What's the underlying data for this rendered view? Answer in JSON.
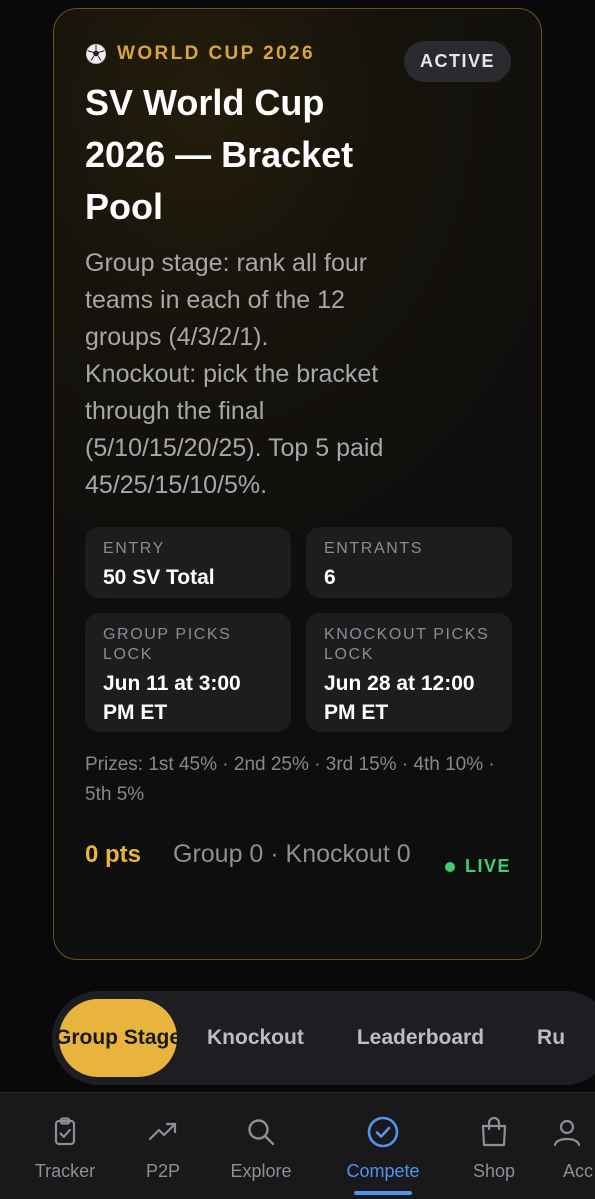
{
  "pool": {
    "eyebrow": "WORLD CUP 2026",
    "eyebrow_icon": "soccer-ball-icon",
    "status": "ACTIVE",
    "title": "SV World Cup 2026 — Bracket Pool",
    "description": "Group stage: rank all four teams in each of the 12 groups (4/3/2/1). Knockout: pick the bracket through the final (5/10/15/20/25). Top 5 paid 45/25/15/10/5%.",
    "stats": [
      {
        "label": "ENTRY",
        "value": "50 SV Total"
      },
      {
        "label": "ENTRANTS",
        "value": "6"
      },
      {
        "label": "GROUP PICKS LOCK",
        "value": "Jun 11 at 3:00 PM ET"
      },
      {
        "label": "KNOCKOUT PICKS LOCK",
        "value": "Jun 28 at 12:00 PM ET"
      }
    ],
    "prizes": "Prizes: 1st 45% · 2nd 25% · 3rd 15% · 4th 10% · 5th 5%",
    "points": "0 pts",
    "breakdown": "Group 0 · Knockout 0",
    "live_label": "LIVE"
  },
  "tabs": [
    {
      "label": "Group Stage",
      "active": true
    },
    {
      "label": "Knockout",
      "active": false
    },
    {
      "label": "Leaderboard",
      "active": false
    },
    {
      "label": "Ru",
      "active": false
    }
  ],
  "bottom_nav": [
    {
      "label": "Tracker",
      "icon": "clipboard-check-icon"
    },
    {
      "label": "P2P",
      "icon": "trending-up-icon"
    },
    {
      "label": "Explore",
      "icon": "search-icon"
    },
    {
      "label": "Compete",
      "icon": "check-circle-icon",
      "active": true
    },
    {
      "label": "Shop",
      "icon": "shopping-bag-icon"
    },
    {
      "label": "Acc",
      "icon": "account-icon"
    }
  ],
  "colors": {
    "accent_gold": "#e8b43d",
    "live_green": "#3ecf6e",
    "active_blue": "#4f95ee"
  }
}
